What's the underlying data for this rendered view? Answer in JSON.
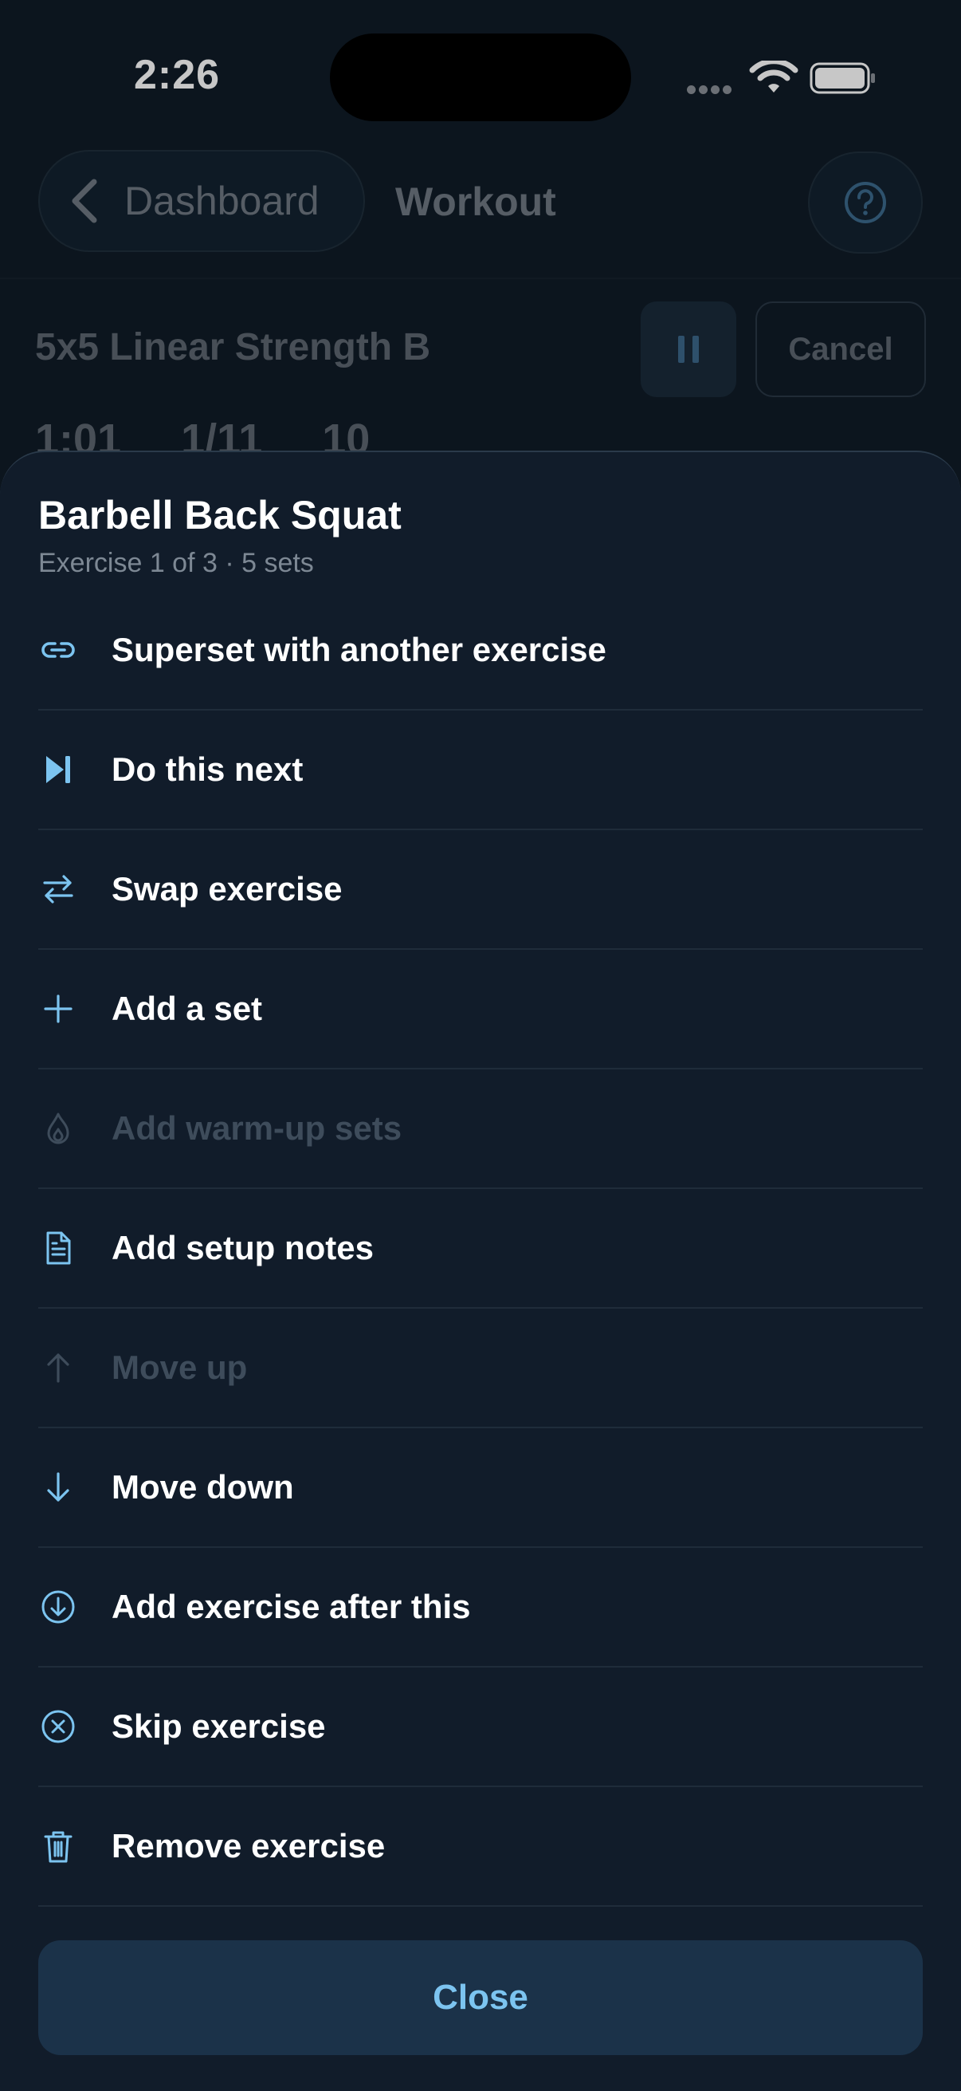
{
  "status_bar": {
    "time": "2:26"
  },
  "nav": {
    "back_label": "Dashboard",
    "title": "Workout"
  },
  "workout": {
    "name": "5x5 Linear Strength B",
    "cancel_label": "Cancel",
    "stats": [
      "1:01",
      "1/11",
      "10"
    ]
  },
  "sheet": {
    "title": "Barbell Back Squat",
    "subtitle": "Exercise 1 of 3 · 5 sets",
    "items": [
      {
        "label": "Superset with another exercise",
        "icon": "link-icon",
        "enabled": true
      },
      {
        "label": "Do this next",
        "icon": "skip-next-icon",
        "enabled": true
      },
      {
        "label": "Swap exercise",
        "icon": "swap-icon",
        "enabled": true
      },
      {
        "label": "Add a set",
        "icon": "plus-icon",
        "enabled": true
      },
      {
        "label": "Add warm-up sets",
        "icon": "flame-icon",
        "enabled": false
      },
      {
        "label": "Add setup notes",
        "icon": "document-icon",
        "enabled": true
      },
      {
        "label": "Move up",
        "icon": "arrow-up-icon",
        "enabled": false
      },
      {
        "label": "Move down",
        "icon": "arrow-down-icon",
        "enabled": true
      },
      {
        "label": "Add exercise after this",
        "icon": "circle-arrow-down-icon",
        "enabled": true
      },
      {
        "label": "Skip exercise",
        "icon": "circle-x-icon",
        "enabled": true
      },
      {
        "label": "Remove exercise",
        "icon": "trash-icon",
        "enabled": true
      }
    ],
    "close_label": "Close"
  },
  "colors": {
    "accent": "#7cc4f0",
    "disabled": "#3e4c5b",
    "sheet_bg": "#111c2a"
  }
}
